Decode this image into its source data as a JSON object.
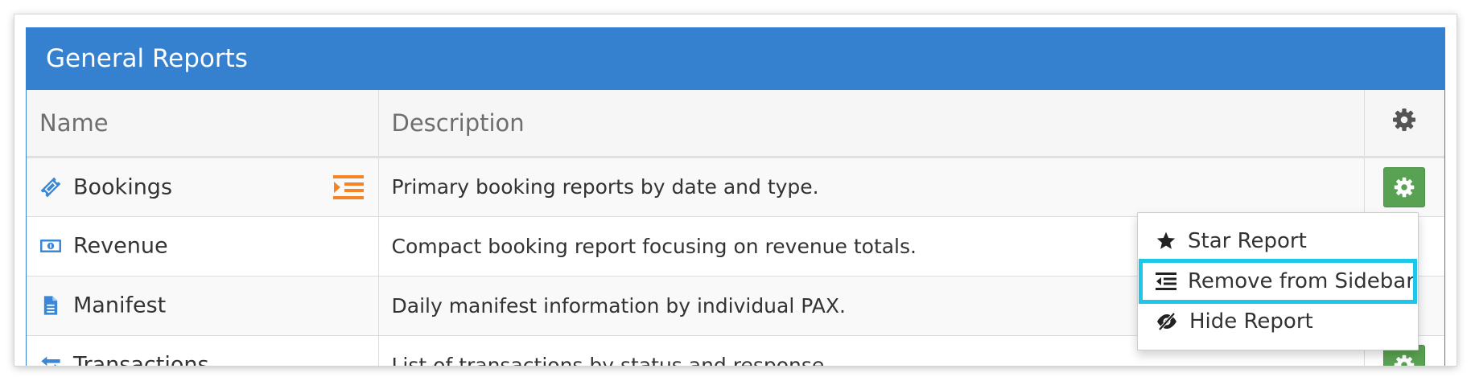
{
  "panel": {
    "title": "General Reports"
  },
  "table": {
    "columns": {
      "name": "Name",
      "description": "Description"
    },
    "rows": [
      {
        "name": "Bookings",
        "icon": "ticket-icon",
        "description": "Primary booking reports by date and type.",
        "in_sidebar": true
      },
      {
        "name": "Revenue",
        "icon": "money-icon",
        "description": "Compact booking report focusing on revenue totals."
      },
      {
        "name": "Manifest",
        "icon": "document-icon",
        "description": "Daily manifest information by individual PAX."
      },
      {
        "name": "Transactions",
        "icon": "exchange-icon",
        "description": "List of transactions by status and response."
      }
    ]
  },
  "dropdown": {
    "items": [
      {
        "label": "Star Report",
        "icon": "star-icon"
      },
      {
        "label": "Remove from Sidebar",
        "icon": "outdent-icon",
        "highlighted": true
      },
      {
        "label": "Hide Report",
        "icon": "eye-slash-icon"
      }
    ]
  },
  "colors": {
    "header_blue": "#3580cf",
    "gear_green": "#5aa253",
    "sidebar_orange": "#f58426",
    "icon_blue": "#3a87d6",
    "highlight_cyan": "#1ec6ea"
  }
}
